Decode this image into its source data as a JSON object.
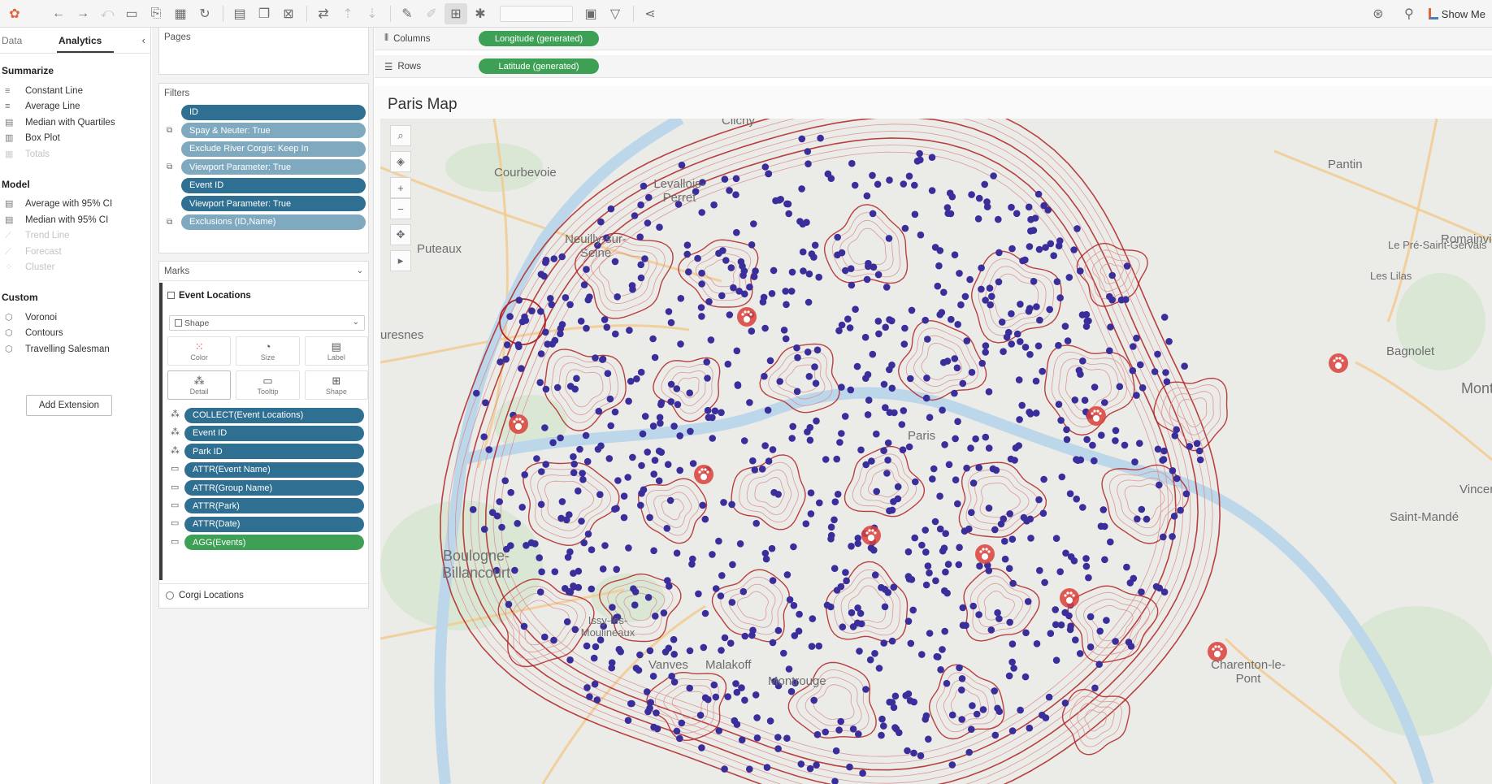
{
  "toolbar": {
    "show_me_label": "Show Me",
    "buttons": [
      "tableau-logo-icon",
      "undo-icon",
      "redo-icon",
      "revert-icon",
      "save-icon",
      "new-datasource-icon",
      "new-sheet-icon",
      "refresh-icon",
      "pause-icon",
      "duplicate-icon",
      "clear-sheet-icon",
      "swap-icon",
      "sort-asc-icon",
      "sort-desc-icon",
      "highlight-icon",
      "annotate-icon",
      "group-icon",
      "show-labels-icon",
      "fix-axes-icon",
      "fit-icon",
      "present-icon",
      "tooltip-icon",
      "share-icon"
    ]
  },
  "left_panel": {
    "tabs": [
      {
        "label": "Data",
        "active": false
      },
      {
        "label": "Analytics",
        "active": true
      }
    ],
    "sections": [
      {
        "title": "Summarize",
        "items": [
          {
            "label": "Constant Line",
            "enabled": true
          },
          {
            "label": "Average Line",
            "enabled": true
          },
          {
            "label": "Median with Quartiles",
            "enabled": true
          },
          {
            "label": "Box Plot",
            "enabled": true
          },
          {
            "label": "Totals",
            "enabled": false
          }
        ]
      },
      {
        "title": "Model",
        "items": [
          {
            "label": "Average with 95% CI",
            "enabled": true
          },
          {
            "label": "Median with 95% CI",
            "enabled": true
          },
          {
            "label": "Trend Line",
            "enabled": false
          },
          {
            "label": "Forecast",
            "enabled": false
          },
          {
            "label": "Cluster",
            "enabled": false
          }
        ]
      },
      {
        "title": "Custom",
        "items": [
          {
            "label": "Voronoi",
            "enabled": true
          },
          {
            "label": "Contours",
            "enabled": true
          },
          {
            "label": "Travelling Salesman",
            "enabled": true
          }
        ]
      }
    ],
    "add_extension_label": "Add Extension"
  },
  "shelves": {
    "pages_label": "Pages",
    "filters_label": "Filters",
    "filters": [
      {
        "label": "ID",
        "style": "blue",
        "icon": ""
      },
      {
        "label": "Spay & Neuter: True",
        "style": "lblue",
        "icon": "filter-icon"
      },
      {
        "label": "Exclude River Corgis: Keep In",
        "style": "lblue",
        "icon": ""
      },
      {
        "label": "Viewport Parameter: True",
        "style": "lblue",
        "icon": "filter-icon"
      },
      {
        "label": "Event ID",
        "style": "blue",
        "icon": ""
      },
      {
        "label": "Viewport Parameter: True",
        "style": "blue",
        "icon": ""
      },
      {
        "label": "Exclusions (ID,Name)",
        "style": "lblue",
        "icon": "filter-icon"
      }
    ],
    "marks_label": "Marks",
    "layer_name": "Event Locations",
    "mark_type": "Shape",
    "mark_buttons": [
      {
        "label": "Color",
        "icon": "color-icon"
      },
      {
        "label": "Size",
        "icon": "size-icon"
      },
      {
        "label": "Label",
        "icon": "label-icon"
      },
      {
        "label": "Detail",
        "icon": "detail-icon"
      },
      {
        "label": "Tooltip",
        "icon": "tooltip-icon"
      },
      {
        "label": "Shape",
        "icon": "shape-icon"
      }
    ],
    "mark_pills": [
      {
        "label": "COLLECT(Event Locations)",
        "style": "blue",
        "icon": "detail-icon"
      },
      {
        "label": "Event ID",
        "style": "blue",
        "icon": "detail-icon"
      },
      {
        "label": "Park ID",
        "style": "blue",
        "icon": "detail-icon"
      },
      {
        "label": "ATTR(Event Name)",
        "style": "blue",
        "icon": "tooltip-icon"
      },
      {
        "label": "ATTR(Group Name)",
        "style": "blue",
        "icon": "tooltip-icon"
      },
      {
        "label": "ATTR(Park)",
        "style": "blue",
        "icon": "tooltip-icon"
      },
      {
        "label": "ATTR(Date)",
        "style": "blue",
        "icon": "tooltip-icon"
      },
      {
        "label": "AGG(Events)",
        "style": "green",
        "icon": "tooltip-icon"
      }
    ],
    "second_layer": "Corgi Locations",
    "columns_label": "Columns",
    "columns_pill": "Longitude (generated)",
    "rows_label": "Rows",
    "rows_pill": "Latitude (generated)"
  },
  "view": {
    "title": "Paris Map",
    "place_labels": [
      "Clichy",
      "Neuilly-sur-Seine",
      "Courbevoie",
      "Levallois-Perret",
      "Puteaux",
      "Suresnes",
      "Pantin",
      "Romainville",
      "Bagnolet",
      "Montreuil",
      "Vincennes",
      "Saint-Mandé",
      "Boulogne-Billancourt",
      "Vanves",
      "Malakoff",
      "Montrouge",
      "Charenton-le-Pont",
      "Issy-les-Moulineaux",
      "Paris",
      "Le Pré-Saint-Gervais",
      "Les Lilas"
    ],
    "colors": {
      "event_dot": "#3a2e9b",
      "contour": "#c0392b",
      "park_marker": "#d9403a",
      "pill_blue": "#2f6f92",
      "pill_green": "#3ea055"
    }
  }
}
